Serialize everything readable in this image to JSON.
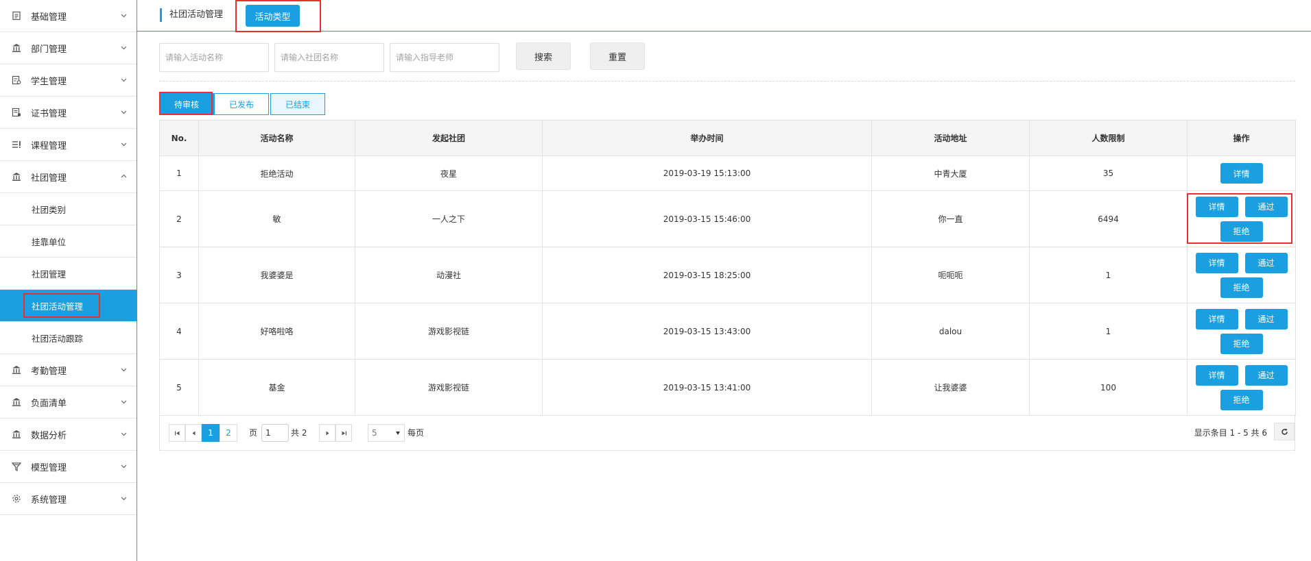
{
  "sidebar": {
    "menus": [
      {
        "label": "基础管理",
        "icon": "doc-icon"
      },
      {
        "label": "部门管理",
        "icon": "bank-icon"
      },
      {
        "label": "学生管理",
        "icon": "student-icon"
      },
      {
        "label": "证书管理",
        "icon": "certificate-icon"
      },
      {
        "label": "课程管理",
        "icon": "list-icon"
      },
      {
        "label": "社团管理",
        "icon": "bank-icon"
      },
      {
        "label": "考勤管理",
        "icon": "bank-icon"
      },
      {
        "label": "负面清单",
        "icon": "bank-icon"
      },
      {
        "label": "数据分析",
        "icon": "bank-icon"
      },
      {
        "label": "模型管理",
        "icon": "funnel-icon"
      },
      {
        "label": "系统管理",
        "icon": "gear-icon"
      }
    ],
    "submenus": [
      {
        "label": "社团类别"
      },
      {
        "label": "挂靠单位"
      },
      {
        "label": "社团管理"
      },
      {
        "label": "社团活动管理"
      },
      {
        "label": "社团活动跟踪"
      }
    ]
  },
  "topbar": {
    "breadcrumb": "社团活动管理",
    "tab": "活动类型"
  },
  "search": {
    "activity_placeholder": "请输入活动名称",
    "club_placeholder": "请输入社团名称",
    "teacher_placeholder": "请输入指导老师",
    "search_label": "搜索",
    "reset_label": "重置"
  },
  "status_tabs": {
    "pending": "待审核",
    "published": "已发布",
    "ended": "已结束"
  },
  "table": {
    "headers": {
      "no": "No.",
      "name": "活动名称",
      "club": "发起社团",
      "time": "举办时间",
      "address": "活动地址",
      "limit": "人数限制",
      "ops": "操作"
    },
    "rows": [
      {
        "no": "1",
        "name": "拒绝活动",
        "club": "夜星",
        "time": "2019-03-19 15:13:00",
        "address": "中青大厦",
        "limit": "35"
      },
      {
        "no": "2",
        "name": "敏",
        "club": "一人之下",
        "time": "2019-03-15 15:46:00",
        "address": "你一直",
        "limit": "6494"
      },
      {
        "no": "3",
        "name": "我婆婆是",
        "club": "动漫社",
        "time": "2019-03-15 18:25:00",
        "address": "呃呃呃",
        "limit": "1"
      },
      {
        "no": "4",
        "name": "好咯啦咯",
        "club": "游戏影视链",
        "time": "2019-03-15 13:43:00",
        "address": "dalou",
        "limit": "1"
      },
      {
        "no": "5",
        "name": "基金",
        "club": "游戏影视链",
        "time": "2019-03-15 13:41:00",
        "address": "让我婆婆",
        "limit": "100"
      }
    ],
    "op_detail": "详情",
    "op_pass": "通过",
    "op_reject": "拒绝"
  },
  "pager": {
    "page1": "1",
    "page2": "2",
    "page_label": "页",
    "page_value": "1",
    "total_label": "共 2",
    "page_size": "5",
    "per_page_label": "每页",
    "summary": "显示条目 1 - 5 共 6"
  },
  "colors": {
    "accent": "#1a9fe0",
    "highlight_box": "#e8302c"
  }
}
